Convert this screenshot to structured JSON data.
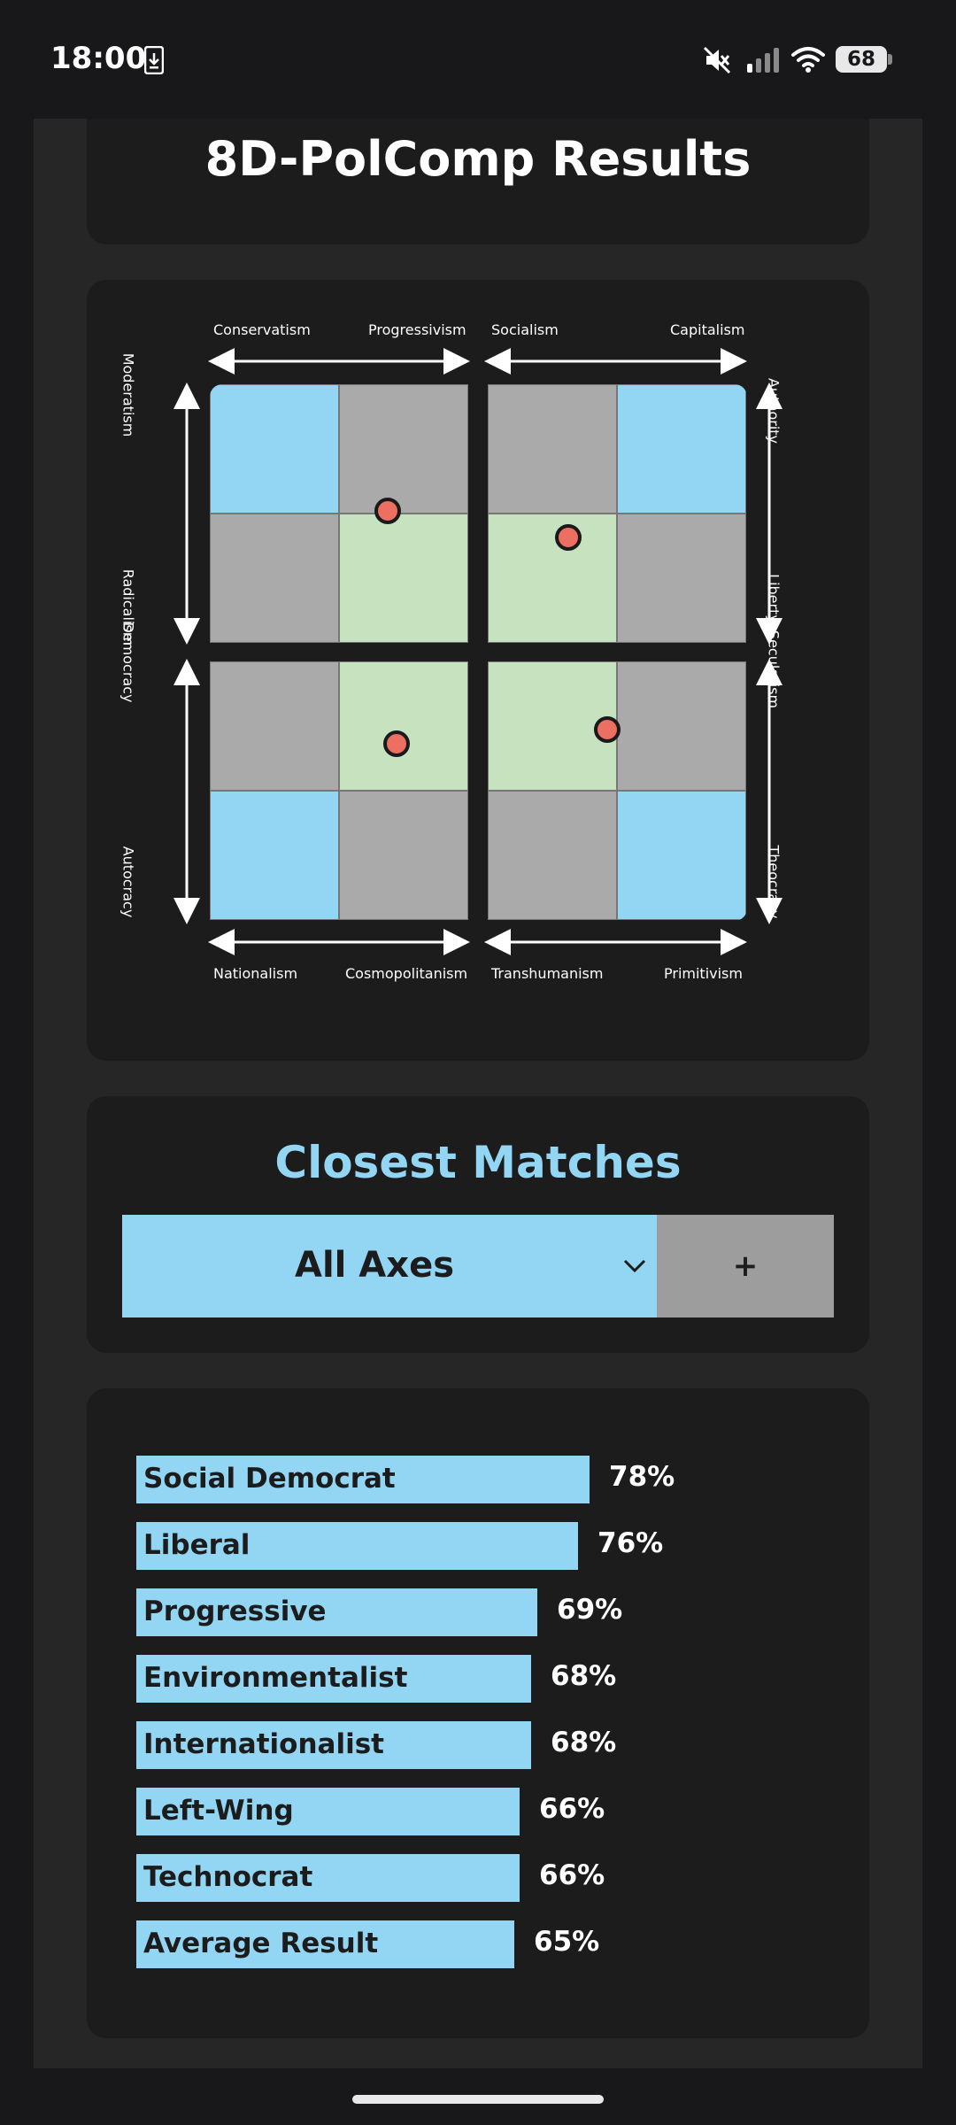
{
  "status_bar": {
    "time": "18:00",
    "battery": "68",
    "icons": [
      "download-notification-icon",
      "mute-icon",
      "signal-icon",
      "wifi-icon",
      "battery-icon"
    ]
  },
  "header": {
    "title": "8D-PolComp Results"
  },
  "compass": {
    "top_labels": [
      "Conservatism",
      "Progressivism",
      "Socialism",
      "Capitalism"
    ],
    "bottom_labels": [
      "Nationalism",
      "Cosmopolitanism",
      "Transhumanism",
      "Primitivism"
    ],
    "left_labels": [
      "Moderatism",
      "Radicalism",
      "Democracy",
      "Autocracy"
    ],
    "right_labels": [
      "Authority",
      "Liberty",
      "Secularism",
      "Theocracy"
    ],
    "colors": {
      "ideal": "#92d6f4",
      "neutral": "#aaaaaa",
      "match": "#c7e2bf",
      "marker": "#ec6f62"
    }
  },
  "matches": {
    "title": "Closest Matches",
    "filter_value": "All Axes",
    "add_label": "+",
    "items": [
      {
        "name": "Social Democrat",
        "pct": "78%",
        "value": 78
      },
      {
        "name": "Liberal",
        "pct": "76%",
        "value": 76
      },
      {
        "name": "Progressive",
        "pct": "69%",
        "value": 69
      },
      {
        "name": "Environmentalist",
        "pct": "68%",
        "value": 68
      },
      {
        "name": "Internationalist",
        "pct": "68%",
        "value": 68
      },
      {
        "name": "Left-Wing",
        "pct": "66%",
        "value": 66
      },
      {
        "name": "Technocrat",
        "pct": "66%",
        "value": 66
      },
      {
        "name": "Average Result",
        "pct": "65%",
        "value": 65
      }
    ]
  }
}
